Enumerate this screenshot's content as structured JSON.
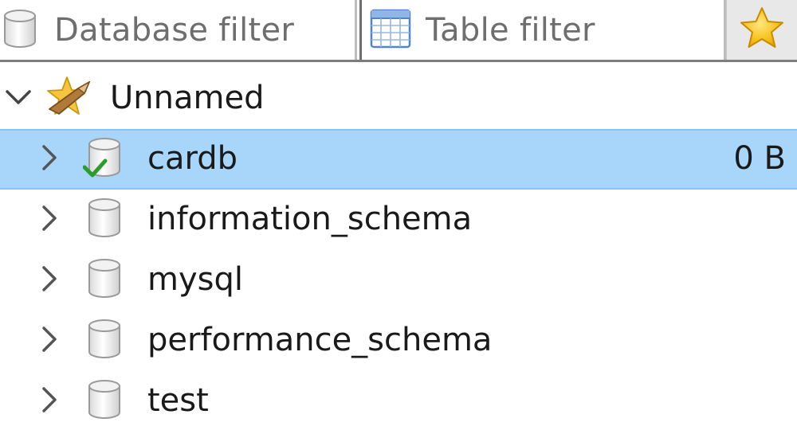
{
  "filters": {
    "database_placeholder": "Database filter",
    "table_placeholder": "Table filter"
  },
  "tree": {
    "session": {
      "label": "Unnamed",
      "expanded": true,
      "icon": "session-icon"
    },
    "databases": [
      {
        "label": "cardb",
        "size": "0 B",
        "selected": true,
        "icon": "database-active-icon"
      },
      {
        "label": "information_schema",
        "size": "",
        "selected": false,
        "icon": "database-icon"
      },
      {
        "label": "mysql",
        "size": "",
        "selected": false,
        "icon": "database-icon"
      },
      {
        "label": "performance_schema",
        "size": "",
        "selected": false,
        "icon": "database-icon"
      },
      {
        "label": "test",
        "size": "",
        "selected": false,
        "icon": "database-icon"
      }
    ]
  },
  "colors": {
    "selection": "#a8d6fb",
    "selection_border": "#88c2f3",
    "placeholder_text": "#6e6e6e",
    "star": "#f5b400"
  }
}
